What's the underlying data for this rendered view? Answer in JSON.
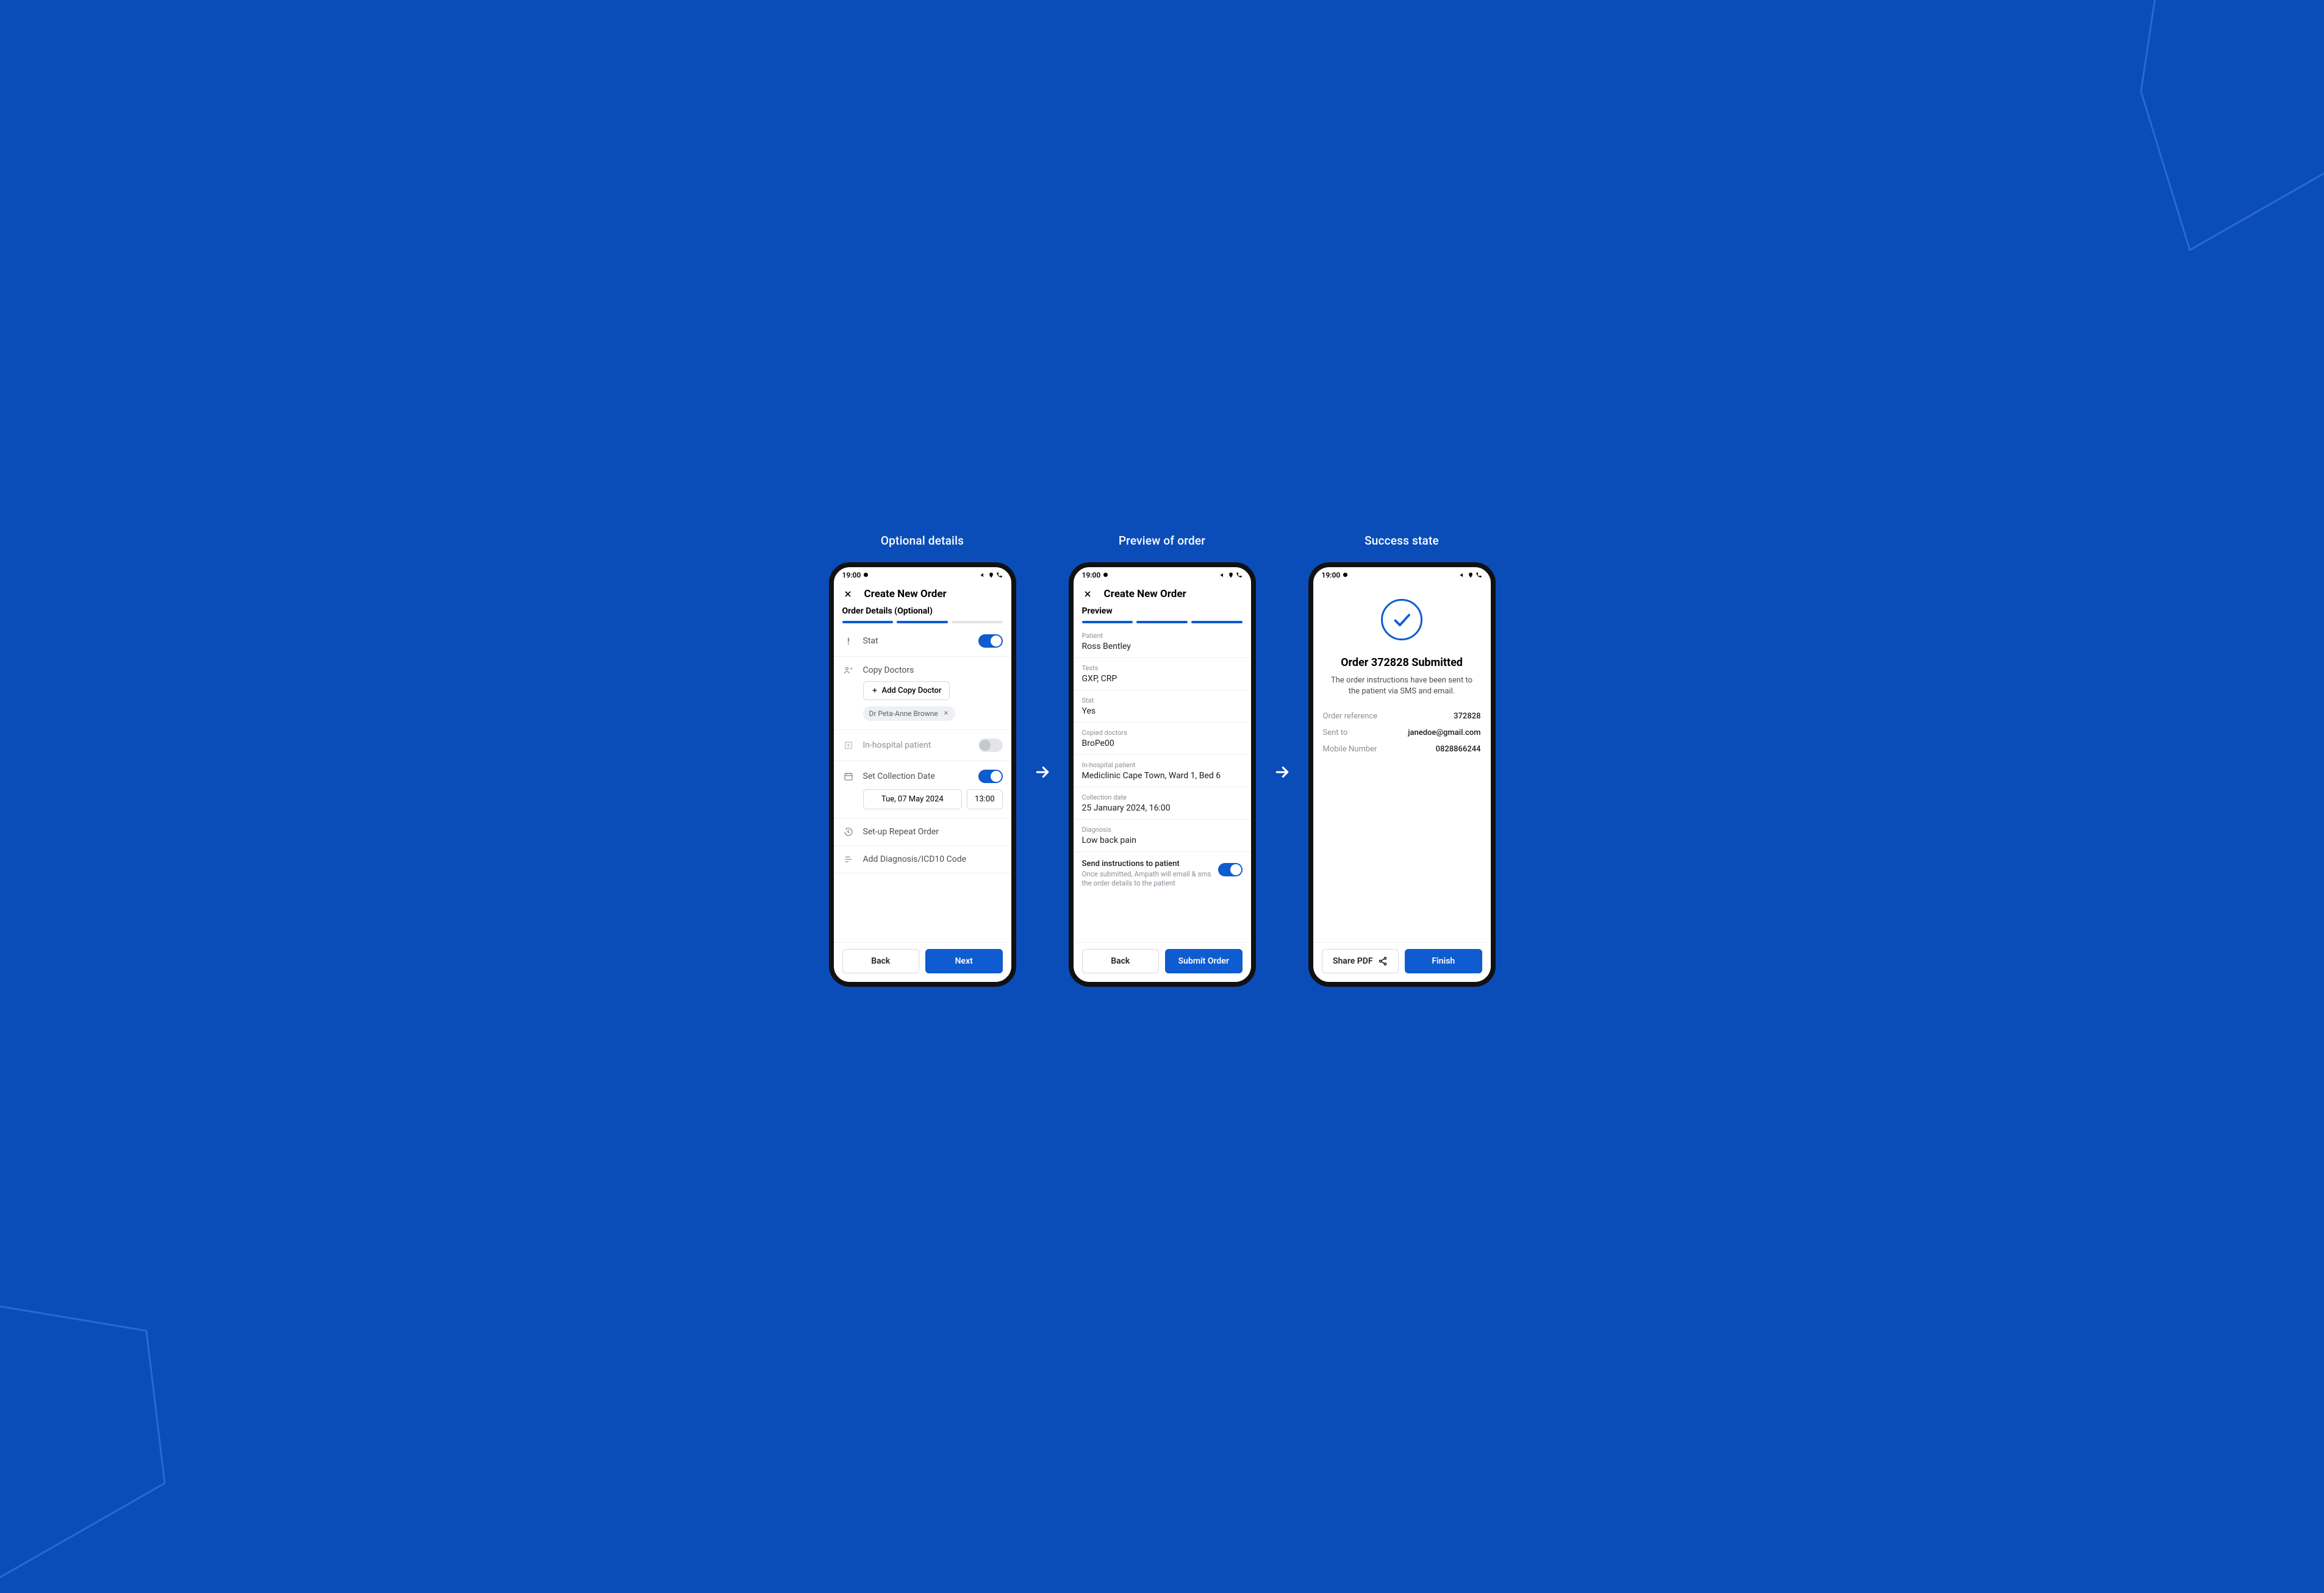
{
  "columns": {
    "optional": "Optional details",
    "preview": "Preview of order",
    "success": "Success state"
  },
  "status_bar": {
    "time": "19:00"
  },
  "header": {
    "title": "Create New Order"
  },
  "optional": {
    "section": "Order Details (Optional)",
    "stat_label": "Stat",
    "copy_doctors_label": "Copy Doctors",
    "add_copy_doctor": "Add Copy Doctor",
    "doctor_chip": "Dr Peta-Anne Browne",
    "in_hospital_label": "In-hospital patient",
    "set_collection_label": "Set Collection Date",
    "collection_date": "Tue, 07 May 2024",
    "collection_time": "13:00",
    "repeat_label": "Set-up Repeat Order",
    "diagnosis_label": "Add Diagnosis/ICD10 Code",
    "back": "Back",
    "next": "Next"
  },
  "preview": {
    "section": "Preview",
    "rows": {
      "patient_l": "Patient",
      "patient_v": "Ross Bentley",
      "tests_l": "Tests",
      "tests_v": "GXP, CRP",
      "stat_l": "Stat",
      "stat_v": "Yes",
      "copied_l": "Copied doctors",
      "copied_v": "BroPe00",
      "hosp_l": "In-hospital patient",
      "hosp_v": "Mediclinic Cape Town, Ward 1, Bed 6",
      "coll_l": "Collection date",
      "coll_v": "25 January 2024, 16:00",
      "diag_l": "Diagnosis",
      "diag_v": "Low back pain"
    },
    "send_title": "Send instructions to patient",
    "send_sub": "Once submitted, Ampath will email & sms the order details to the patient",
    "back": "Back",
    "submit": "Submit Order"
  },
  "success": {
    "title": "Order 372828 Submitted",
    "subtitle": "The order instructions have been sent to the patient via SMS and email.",
    "ref_l": "Order reference",
    "ref_v": "372828",
    "sent_l": "Sent to",
    "sent_v": "janedoe@gmail.com",
    "mob_l": "Mobile Number",
    "mob_v": "0828866244",
    "share": "Share PDF",
    "finish": "Finish"
  }
}
